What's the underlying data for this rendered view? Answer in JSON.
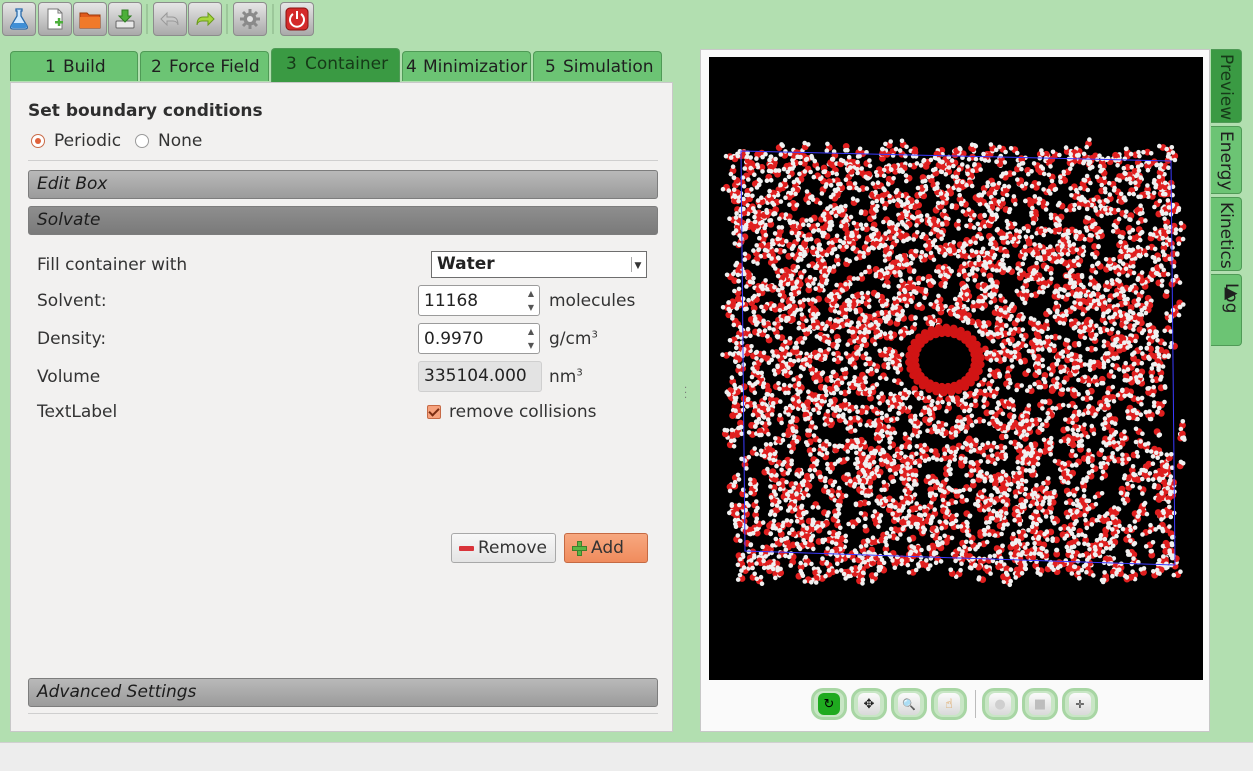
{
  "toolbar": {
    "buttons": [
      {
        "name": "new-project-flask-icon"
      },
      {
        "name": "new-file-icon"
      },
      {
        "name": "open-folder-icon"
      },
      {
        "name": "save-download-icon"
      },
      {
        "name": "undo-arrow-icon"
      },
      {
        "name": "redo-arrow-icon"
      },
      {
        "name": "settings-gear-icon"
      },
      {
        "name": "power-icon"
      }
    ]
  },
  "tabs": [
    {
      "num": "1",
      "label": "Build"
    },
    {
      "num": "2",
      "label": "Force Field"
    },
    {
      "num": "3",
      "label": "Container"
    },
    {
      "num": "4",
      "label": "Minimizatior"
    },
    {
      "num": "5",
      "label": "Simulation"
    }
  ],
  "active_tab": "Container",
  "boundary": {
    "title": "Set boundary conditions",
    "options": [
      "Periodic",
      "None"
    ],
    "selected": "Periodic"
  },
  "sections": {
    "edit_box": "Edit Box",
    "solvate": "Solvate",
    "advanced": "Advanced Settings"
  },
  "solvate": {
    "fill_label": "Fill container with",
    "fill_value": "Water",
    "solvent_label": "Solvent:",
    "solvent_value": "11168",
    "solvent_unit": "molecules",
    "density_label": "Density:",
    "density_value": "0.9970",
    "density_unit": "g/cm",
    "density_unit_sup": "3",
    "volume_label": "Volume",
    "volume_value": "335104.000",
    "volume_unit": "nm",
    "volume_unit_sup": "3",
    "text_label": "TextLabel",
    "remove_collisions_label": "remove collisions",
    "remove_collisions_checked": true,
    "remove_button": "Remove",
    "add_button": "Add"
  },
  "side_tabs": [
    {
      "label": "Preview",
      "active": true
    },
    {
      "label": "Energy",
      "active": false
    },
    {
      "label": "Kinetics",
      "active": false
    },
    {
      "label": "Log",
      "active": false,
      "prefix": "▶"
    }
  ],
  "viewer_tools": [
    {
      "name": "rotate-icon",
      "glyph": "↻",
      "active": true
    },
    {
      "name": "move-arrows-icon",
      "glyph": "✥",
      "active": false
    },
    {
      "name": "zoom-magnifier-icon",
      "glyph": "🔍",
      "active": false
    },
    {
      "name": "pointer-hand-icon",
      "glyph": "☝",
      "active": false
    },
    {
      "name": "sphere-view-icon",
      "glyph": "●",
      "active": false
    },
    {
      "name": "box-view-icon",
      "glyph": "■",
      "active": false
    },
    {
      "name": "center-icon",
      "glyph": "✛",
      "active": false
    }
  ],
  "colors": {
    "background": "#b2dfb0",
    "tab": "#6cc474",
    "tab_active": "#3a9a43",
    "water_oxygen": "#e01f1f",
    "water_hydrogen": "#f0f0f0",
    "box_outline": "#3a3aff",
    "accent_orange": "#f08c5d"
  }
}
